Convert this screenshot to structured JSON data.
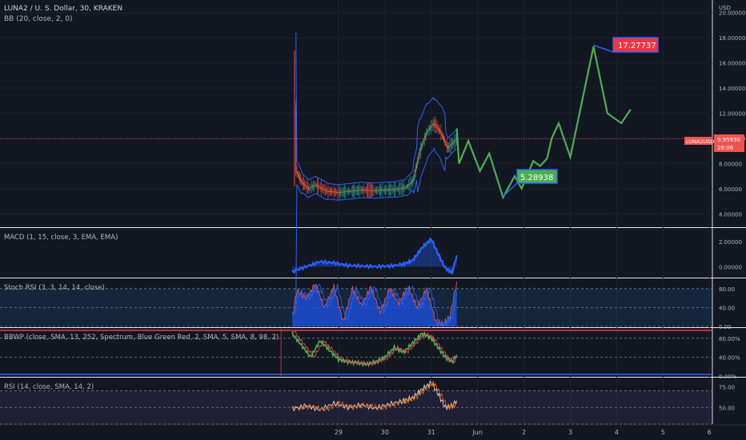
{
  "header": {
    "symbol": "LUNA2 / U. S. Dollar, 30, KRAKEN",
    "bb": "BB (20, close, 2, 0)"
  },
  "axis_currency": "USD",
  "price_tag": {
    "symbol": "LUNA2USD",
    "price": "9.95930",
    "countdown": "26:06"
  },
  "callouts": {
    "high": "17.27737",
    "low": "5.28938"
  },
  "x_labels": [
    "29",
    "30",
    "31",
    "Jun",
    "2",
    "3",
    "4",
    "5",
    "6"
  ],
  "colors": {
    "background": "#131722",
    "up": "#26a69a",
    "down": "#ef5350",
    "projection": "#4caf50",
    "bb": "#2962ff",
    "macd": "#2962ff",
    "stoch": "#1e53e5",
    "rsi": "#d1d4dc",
    "price_line": "#ef5350"
  },
  "chart_data": [
    {
      "type": "line",
      "name": "price",
      "ylim": [
        3,
        21
      ],
      "y_ticks": [
        "4.00000",
        "6.00000",
        "8.00000",
        "10.00000",
        "12.00000",
        "14.00000",
        "16.00000",
        "18.00000",
        "20.00000"
      ],
      "x_ticks": [
        "29",
        "30",
        "31",
        "Jun",
        "2",
        "3",
        "4",
        "5",
        "6"
      ],
      "last_price": 9.9593,
      "series": [
        {
          "values": [
            [
              28.05,
              16.8
            ],
            [
              28.07,
              7.5
            ],
            [
              28.2,
              6.5
            ],
            [
              28.35,
              6.0
            ],
            [
              28.5,
              6.3
            ],
            [
              28.75,
              5.8
            ],
            [
              29.0,
              5.7
            ],
            [
              29.25,
              5.8
            ],
            [
              29.5,
              5.9
            ],
            [
              29.75,
              5.85
            ],
            [
              30.0,
              5.9
            ],
            [
              30.25,
              5.95
            ],
            [
              30.45,
              6.1
            ],
            [
              30.6,
              6.6
            ],
            [
              30.75,
              9.0
            ],
            [
              30.9,
              10.5
            ],
            [
              31.05,
              11.2
            ],
            [
              31.2,
              10.5
            ],
            [
              31.35,
              9.2
            ],
            [
              31.45,
              9.6
            ],
            [
              31.55,
              9.95
            ]
          ]
        },
        {
          "values": [
            [
              31.55,
              10.8
            ],
            [
              31.6,
              8.0
            ],
            [
              31.8,
              9.8
            ],
            [
              32.05,
              7.4
            ],
            [
              32.25,
              8.8
            ],
            [
              32.55,
              5.3
            ],
            [
              32.8,
              7.0
            ],
            [
              32.95,
              6.0
            ],
            [
              33.2,
              8.2
            ],
            [
              33.35,
              7.8
            ],
            [
              33.5,
              8.4
            ],
            [
              33.6,
              10.0
            ],
            [
              33.75,
              11.2
            ],
            [
              34.0,
              8.5
            ],
            [
              34.5,
              17.3
            ],
            [
              34.8,
              12.0
            ],
            [
              35.1,
              11.2
            ],
            [
              35.3,
              12.3
            ]
          ]
        }
      ],
      "bands": {
        "upper_max": 12.5,
        "lower_min": 4.0
      }
    },
    {
      "type": "area",
      "name": "MACD (1, 15, close, 3, EMA, EMA)",
      "ylim": [
        -0.8,
        3.0
      ],
      "y_ticks": [
        "0.00000",
        "2.00000"
      ],
      "x": [
        28.0,
        28.3,
        28.6,
        28.9,
        29.2,
        29.5,
        29.8,
        30.1,
        30.4,
        30.6,
        30.8,
        31.0,
        31.15,
        31.3,
        31.45,
        31.55
      ],
      "values": [
        -0.4,
        0.0,
        0.4,
        0.3,
        0.1,
        0.05,
        0.0,
        0.05,
        0.2,
        0.5,
        1.5,
        2.2,
        1.0,
        -0.1,
        -0.5,
        0.9
      ]
    },
    {
      "type": "area",
      "name": "Stoch RSI (3, 3, 14, 14, close)",
      "ylim": [
        0,
        100
      ],
      "y_ticks": [
        "0.00",
        "40.00",
        "80.00"
      ],
      "x": [
        28.0,
        28.1,
        28.3,
        28.5,
        28.7,
        28.9,
        29.1,
        29.3,
        29.5,
        29.7,
        29.9,
        30.1,
        30.3,
        30.5,
        30.7,
        30.9,
        31.1,
        31.25,
        31.4,
        31.55
      ],
      "values": [
        20,
        75,
        60,
        90,
        40,
        85,
        10,
        80,
        45,
        85,
        30,
        80,
        50,
        85,
        40,
        80,
        10,
        5,
        20,
        95
      ]
    },
    {
      "type": "line",
      "name": "BBWP (close, SMA, 13, 252, Spectrum, Blue Green Red, 2, SMA, 5, SMA, 8, 98, 2)",
      "ylim": [
        0,
        100
      ],
      "y_ticks": [
        "0.00%",
        "40.00%",
        "80.00%"
      ],
      "x": [
        28.0,
        28.2,
        28.4,
        28.6,
        28.8,
        29.0,
        29.2,
        29.4,
        29.6,
        29.8,
        30.0,
        30.2,
        30.4,
        30.6,
        30.8,
        31.0,
        31.15,
        31.3,
        31.45,
        31.55
      ],
      "values": [
        90,
        65,
        40,
        75,
        55,
        35,
        30,
        28,
        25,
        30,
        40,
        60,
        50,
        70,
        90,
        80,
        60,
        40,
        30,
        45
      ]
    },
    {
      "type": "line",
      "name": "RSI (14, close, SMA, 14, 2)",
      "ylim": [
        30,
        85
      ],
      "y_ticks": [
        "50.00",
        "75.00"
      ],
      "x": [
        28.0,
        28.3,
        28.6,
        28.9,
        29.2,
        29.5,
        29.8,
        30.1,
        30.4,
        30.6,
        30.8,
        31.0,
        31.15,
        31.3,
        31.45,
        31.55
      ],
      "values": [
        48,
        52,
        47,
        55,
        50,
        53,
        49,
        54,
        58,
        62,
        72,
        80,
        66,
        50,
        52,
        58
      ]
    }
  ]
}
